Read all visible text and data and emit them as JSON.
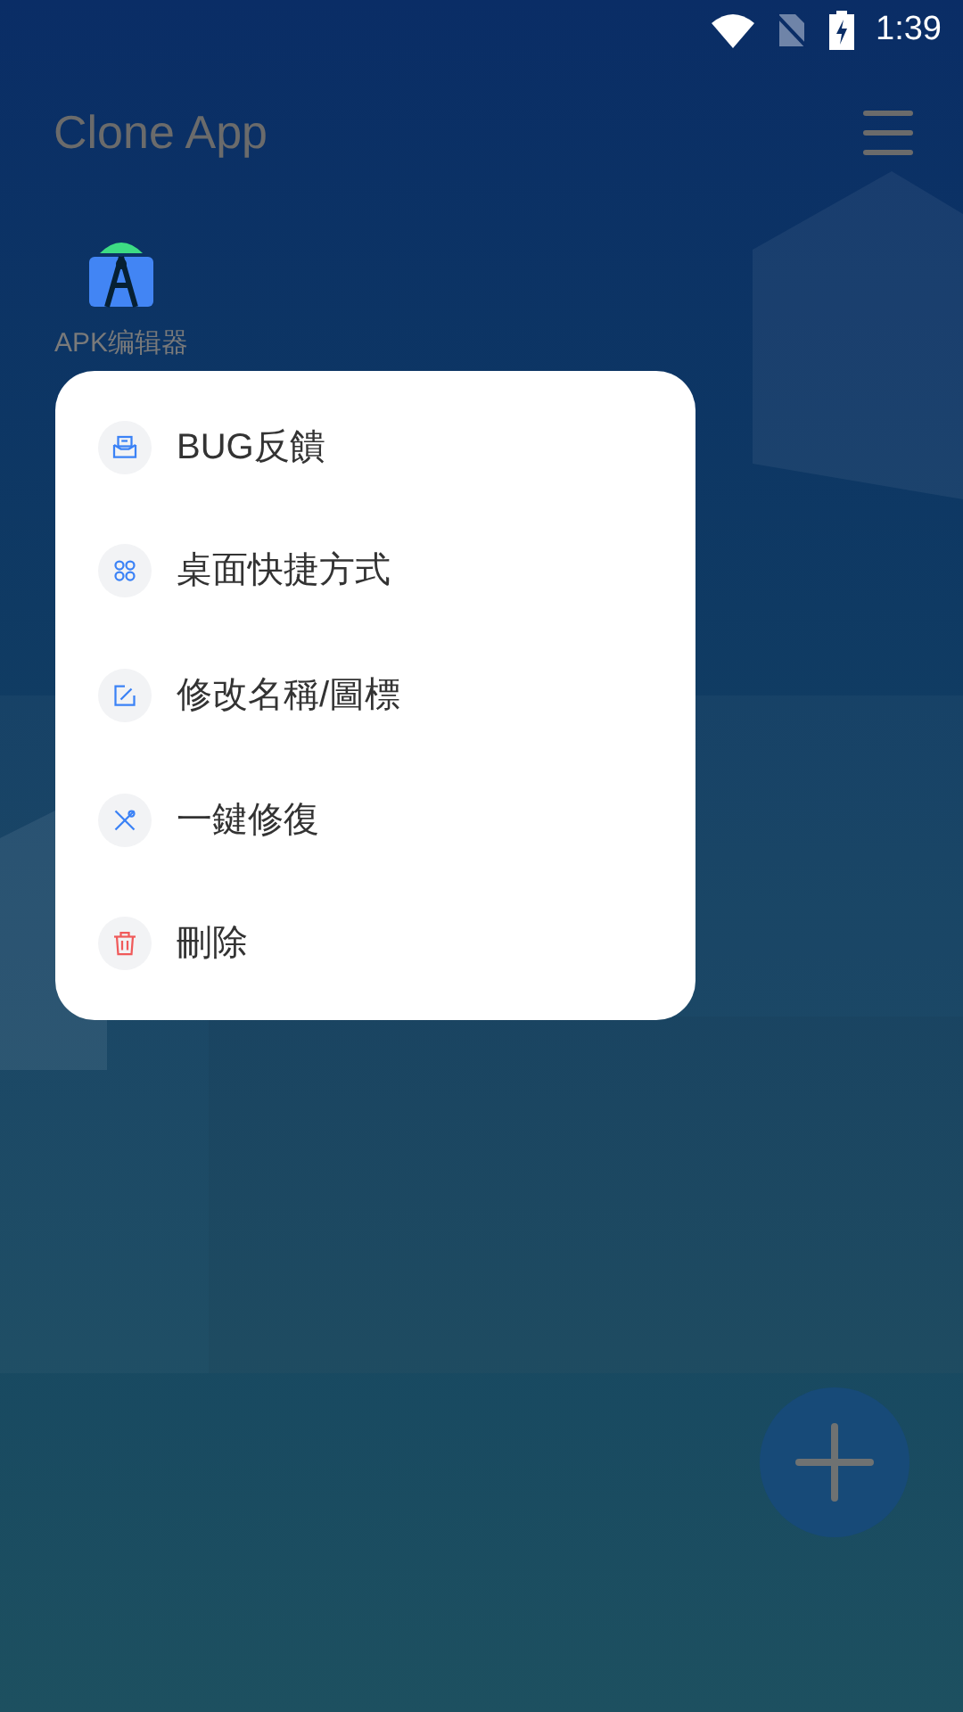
{
  "status_bar": {
    "time": "1:39"
  },
  "header": {
    "title": "Clone App"
  },
  "apps": [
    {
      "label": "APK编辑器"
    }
  ],
  "context_menu": {
    "items": [
      {
        "kind": "feedback",
        "label": "BUG反饋"
      },
      {
        "kind": "shortcut",
        "label": "桌面快捷方式"
      },
      {
        "kind": "rename",
        "label": "修改名稱/圖標"
      },
      {
        "kind": "repair",
        "label": "一鍵修復"
      },
      {
        "kind": "delete",
        "label": "刪除"
      }
    ]
  }
}
